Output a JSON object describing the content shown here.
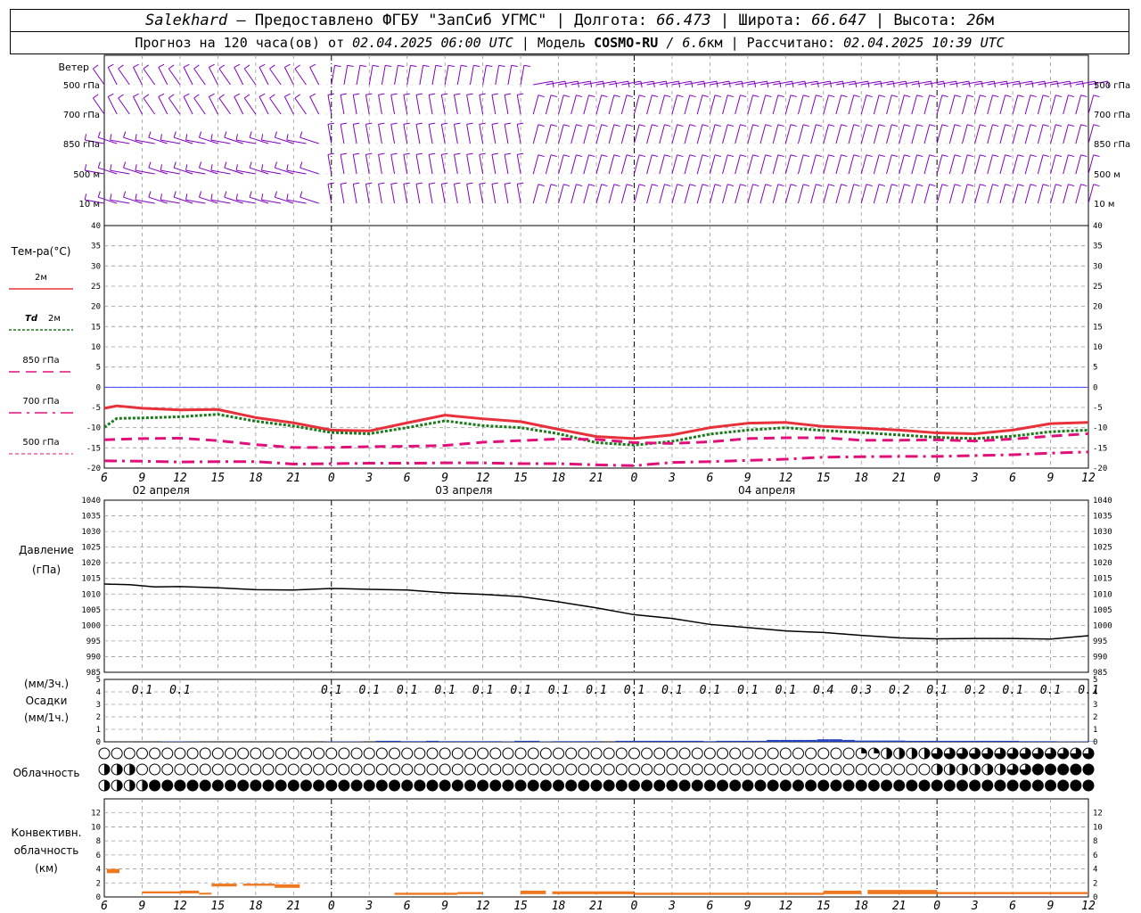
{
  "header": {
    "station": "Salekhard",
    "provider": "– Предоставлено ФГБУ \"ЗапСиб УГМС\" |",
    "lon_label": "Долгота:",
    "lon_value": "66.473",
    "lat_label": "| Широта:",
    "lat_value": "66.647",
    "alt_label": "| Высота:",
    "alt_value": "26",
    "alt_unit": "м",
    "forecast_label": "Прогноз на 120 часа(ов) от",
    "forecast_start": "02.04.2025 06:00 UTC",
    "model_label": "| Модель",
    "model_name": "COSMO-RU",
    "model_res": "/ 6.6",
    "model_res_unit": "км",
    "calc_label": "| Рассчитано:",
    "calc_time": "02.04.2025 10:39 UTC"
  },
  "colors": {
    "wind": "#8000c0",
    "t2m": "#e8303a",
    "td2m": "#1a7a1a",
    "t850": "#e0107a",
    "t700": "#e0107a",
    "t500": "#e0107a",
    "zero_line": "#4040ff",
    "pressure": "#000000",
    "precip": "#2040c0",
    "conv": "#f07820"
  },
  "wind_panel": {
    "title": "Ветер",
    "levels": [
      "500 гПа",
      "700 гПа",
      "850 гПа",
      "500 м",
      "10 м"
    ]
  },
  "temp_legend": {
    "title": "Тем-ра(°С)",
    "t2m": "2м",
    "td_prefix": "Td",
    "td_suffix": "2м",
    "t850": "850 гПа",
    "t700": "700 гПа",
    "t500": "500 гПа"
  },
  "pressure_panel": {
    "title": "Давление",
    "unit": "(гПа)"
  },
  "precip_panel": {
    "unit3h": "(мм/3ч.)",
    "title": "Осадки",
    "unit1h": "(мм/1ч.)",
    "labels": [
      {
        "x": 9,
        "text": "0.1"
      },
      {
        "x": 12,
        "text": "0.1"
      },
      {
        "x": 24,
        "text": "0.1"
      },
      {
        "x": 27,
        "text": "0.1"
      },
      {
        "x": 30,
        "text": "0.1"
      },
      {
        "x": 33,
        "text": "0.1"
      },
      {
        "x": 36,
        "text": "0.1"
      },
      {
        "x": 39,
        "text": "0.1"
      },
      {
        "x": 42,
        "text": "0.1"
      },
      {
        "x": 45,
        "text": "0.1"
      },
      {
        "x": 48,
        "text": "0.1"
      },
      {
        "x": 51,
        "text": "0.1"
      },
      {
        "x": 54,
        "text": "0.1"
      },
      {
        "x": 57,
        "text": "0.1"
      },
      {
        "x": 60,
        "text": "0.1"
      },
      {
        "x": 63,
        "text": "0.4"
      },
      {
        "x": 66,
        "text": "0.3"
      },
      {
        "x": 69,
        "text": "0.2"
      },
      {
        "x": 72,
        "text": "0.1"
      },
      {
        "x": 75,
        "text": "0.2"
      },
      {
        "x": 78,
        "text": "0.1"
      },
      {
        "x": 81,
        "text": "0.1"
      },
      {
        "x": 84,
        "text": "0.1"
      }
    ]
  },
  "cloud_panel": {
    "title": "Облачность"
  },
  "conv_panel": {
    "line1": "Конвективн.",
    "line2": "облачность",
    "line3": "(км)"
  },
  "date_labels": [
    {
      "x": 10.5,
      "text": "02 апреля"
    },
    {
      "x": 34.5,
      "text": "03 апреля"
    },
    {
      "x": 58.5,
      "text": "04 апреля"
    }
  ],
  "chart_data": [
    {
      "type": "line",
      "name": "temperature",
      "xlabel": "",
      "ylabel": "Тем-ра(°С)",
      "xlim": [
        6,
        84
      ],
      "ylim": [
        -20,
        40
      ],
      "x_ticks": [
        "6",
        "9",
        "12",
        "15",
        "18",
        "21",
        "0",
        "3",
        "6",
        "9",
        "12",
        "15",
        "18",
        "21",
        "0",
        "3",
        "6",
        "9",
        "12",
        "15",
        "18",
        "21",
        "0",
        "3",
        "6",
        "9",
        "12"
      ],
      "y_ticks": [
        40,
        35,
        30,
        25,
        20,
        15,
        10,
        5,
        0,
        -5,
        -10,
        -15,
        -20
      ],
      "grid": true,
      "series": [
        {
          "name": "2м",
          "x": [
            6,
            7,
            9,
            12,
            15,
            18,
            21,
            24,
            27,
            30,
            33,
            36,
            39,
            42,
            45,
            48,
            51,
            54,
            57,
            60,
            63,
            66,
            69,
            72,
            75,
            78,
            81,
            84
          ],
          "values": [
            -5.2,
            -4.6,
            -5.2,
            -5.6,
            -5.5,
            -7.5,
            -8.8,
            -10.6,
            -10.8,
            -8.8,
            -6.9,
            -7.8,
            -8.5,
            -10.4,
            -12.2,
            -12.7,
            -11.8,
            -10.0,
            -8.9,
            -8.7,
            -9.7,
            -10.1,
            -10.6,
            -11.3,
            -11.5,
            -10.6,
            -9.0,
            -8.7
          ]
        },
        {
          "name": "Td 2м",
          "x": [
            6,
            7,
            9,
            12,
            15,
            18,
            21,
            24,
            27,
            30,
            33,
            36,
            39,
            42,
            45,
            48,
            51,
            54,
            57,
            60,
            63,
            66,
            69,
            72,
            75,
            78,
            81,
            84
          ],
          "values": [
            -9.9,
            -7.7,
            -7.6,
            -7.3,
            -6.7,
            -8.4,
            -9.6,
            -11.2,
            -11.5,
            -10.0,
            -8.3,
            -9.5,
            -10.0,
            -11.5,
            -13.7,
            -14.3,
            -13.4,
            -11.6,
            -10.6,
            -10.0,
            -10.7,
            -11.2,
            -11.8,
            -12.4,
            -12.7,
            -12.1,
            -11.0,
            -10.6
          ]
        },
        {
          "name": "850 гПа",
          "x": [
            6,
            9,
            12,
            15,
            18,
            21,
            24,
            27,
            30,
            33,
            36,
            39,
            42,
            45,
            48,
            51,
            54,
            57,
            60,
            63,
            66,
            69,
            72,
            75,
            78,
            81,
            84
          ],
          "values": [
            -13,
            -12.7,
            -12.6,
            -13.2,
            -14.2,
            -14.9,
            -14.9,
            -14.7,
            -14.6,
            -14.4,
            -13.6,
            -13.2,
            -12.8,
            -12.9,
            -13.7,
            -13.9,
            -13.5,
            -12.7,
            -12.5,
            -12.5,
            -13.1,
            -13.1,
            -13.0,
            -13.3,
            -12.8,
            -12.1,
            -11.5
          ]
        },
        {
          "name": "700 гПа",
          "x": [
            6,
            9,
            12,
            15,
            18,
            21,
            24,
            27,
            30,
            33,
            36,
            39,
            42,
            45,
            48,
            51,
            54,
            57,
            60,
            63,
            66,
            69,
            72,
            75,
            78,
            81,
            84
          ],
          "values": [
            -18.2,
            -18.3,
            -18.5,
            -18.4,
            -18.4,
            -19.0,
            -18.9,
            -18.8,
            -18.8,
            -18.7,
            -18.7,
            -18.9,
            -18.9,
            -19.2,
            -19.4,
            -18.6,
            -18.4,
            -18.1,
            -17.8,
            -17.3,
            -17.2,
            -17.1,
            -17.1,
            -16.9,
            -16.7,
            -16.3,
            -16.0
          ]
        }
      ]
    },
    {
      "type": "line",
      "name": "pressure",
      "ylabel": "Давление",
      "xlim": [
        6,
        84
      ],
      "ylim": [
        985,
        1040
      ],
      "y_ticks": [
        1040,
        1035,
        1030,
        1025,
        1020,
        1015,
        1010,
        1005,
        1000,
        995,
        990,
        985
      ],
      "grid": true,
      "series": [
        {
          "name": "",
          "x": [
            6,
            8,
            10,
            12,
            15,
            18,
            21,
            24,
            27,
            30,
            33,
            36,
            39,
            42,
            45,
            48,
            51,
            54,
            57,
            60,
            63,
            66,
            69,
            72,
            75,
            78,
            81,
            84
          ],
          "values": [
            1013.2,
            1013.0,
            1012.3,
            1012.4,
            1012.0,
            1011.4,
            1011.3,
            1011.8,
            1011.5,
            1011.3,
            1010.4,
            1009.9,
            1009.2,
            1007.5,
            1005.6,
            1003.4,
            1002.2,
            1000.3,
            999.3,
            998.2,
            997.7,
            996.8,
            996.0,
            995.7,
            995.8,
            995.8,
            995.6,
            996.7
          ]
        }
      ]
    },
    {
      "type": "bar",
      "name": "precipitation",
      "ylabel": "Осадки",
      "ylim": [
        0,
        5
      ],
      "y_ticks": [
        5,
        4,
        3,
        2,
        1,
        0
      ],
      "x": [
        11,
        12,
        13,
        24,
        25,
        26,
        28,
        29,
        30,
        31,
        32,
        33,
        34,
        35,
        36,
        37,
        38,
        39,
        40,
        41,
        42,
        43,
        44,
        45,
        47,
        48,
        49,
        50,
        51,
        52,
        53,
        54,
        55,
        56,
        57,
        58,
        59,
        60,
        61,
        62,
        63,
        64,
        65,
        66,
        67,
        68,
        69,
        70,
        71,
        72,
        73,
        74,
        75,
        76,
        77,
        78,
        79,
        80,
        81,
        82,
        83,
        84
      ],
      "values": [
        0.03,
        0.03,
        0.02,
        0.03,
        0.03,
        0.03,
        0.08,
        0.08,
        0.05,
        0.05,
        0.08,
        0.05,
        0.05,
        0.05,
        0.05,
        0.05,
        0.03,
        0.08,
        0.08,
        0.03,
        0.05,
        0.05,
        0.05,
        0.05,
        0.08,
        0.08,
        0.08,
        0.08,
        0.08,
        0.08,
        0.08,
        0.05,
        0.08,
        0.08,
        0.08,
        0.08,
        0.15,
        0.15,
        0.15,
        0.15,
        0.2,
        0.2,
        0.15,
        0.1,
        0.1,
        0.1,
        0.1,
        0.08,
        0.08,
        0.08,
        0.08,
        0.08,
        0.08,
        0.08,
        0.08,
        0.08,
        0.05,
        0.05,
        0.05,
        0.03,
        0.03,
        0.03
      ]
    },
    {
      "type": "bar",
      "name": "convective_cloud",
      "ylabel": "Конвективн. облачность (км)",
      "ylim": [
        0,
        14
      ],
      "y_ticks": [
        12,
        10,
        8,
        6,
        4,
        2,
        0
      ],
      "segments": [
        {
          "x0": 6.2,
          "x1": 7.2,
          "bottom": 3.4,
          "top": 4.0
        },
        {
          "x0": 9,
          "x1": 12,
          "bottom": 0.5,
          "top": 0.8
        },
        {
          "x0": 12,
          "x1": 13.5,
          "bottom": 0.5,
          "top": 0.9
        },
        {
          "x0": 13.5,
          "x1": 14.5,
          "bottom": 0.4,
          "top": 0.6
        },
        {
          "x0": 14.5,
          "x1": 16.5,
          "bottom": 1.5,
          "top": 1.9
        },
        {
          "x0": 17,
          "x1": 19.5,
          "bottom": 1.6,
          "top": 1.9
        },
        {
          "x0": 19.5,
          "x1": 21.5,
          "bottom": 1.3,
          "top": 1.8
        },
        {
          "x0": 29,
          "x1": 34,
          "bottom": 0.3,
          "top": 0.6
        },
        {
          "x0": 34,
          "x1": 36,
          "bottom": 0.4,
          "top": 0.7
        },
        {
          "x0": 39,
          "x1": 41,
          "bottom": 0.4,
          "top": 0.9
        },
        {
          "x0": 41.5,
          "x1": 48,
          "bottom": 0.4,
          "top": 0.8
        },
        {
          "x0": 48,
          "x1": 63,
          "bottom": 0.3,
          "top": 0.6
        },
        {
          "x0": 63,
          "x1": 66,
          "bottom": 0.4,
          "top": 0.9
        },
        {
          "x0": 66.5,
          "x1": 72,
          "bottom": 0.4,
          "top": 1.0
        },
        {
          "x0": 72,
          "x1": 84,
          "bottom": 0.4,
          "top": 0.7
        }
      ]
    }
  ]
}
